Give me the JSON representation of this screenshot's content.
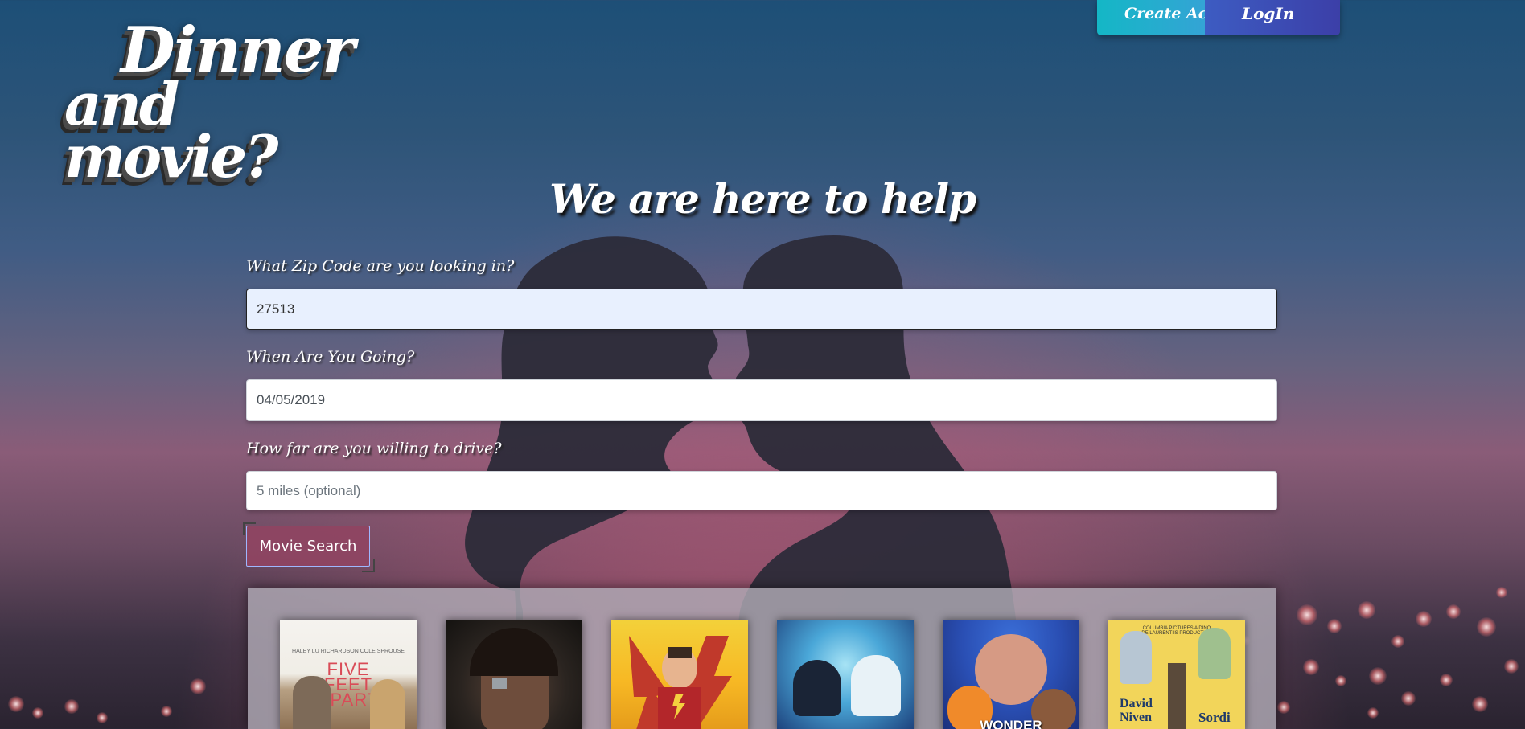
{
  "logo": {
    "line1": "Dinner",
    "line2": "and movie?"
  },
  "nav": {
    "create_account": "Create Account",
    "login": "LogIn"
  },
  "heading": "We are here to help",
  "form": {
    "zip": {
      "label": "What Zip Code are you looking in?",
      "value": "27513"
    },
    "date": {
      "label": "When Are You Going?",
      "value": "04/05/2019"
    },
    "distance": {
      "label": "How far are you willing to drive?",
      "placeholder": "5 miles (optional)"
    },
    "search_button": "Movie Search"
  },
  "posters": [
    {
      "name": "five-feet-apart",
      "title": "FIVE FEET APART",
      "credits": "HALEY LU RICHARDSON  COLE SPROUSE"
    },
    {
      "name": "us",
      "title": ""
    },
    {
      "name": "shazam",
      "title": ""
    },
    {
      "name": "how-to-train-your-dragon",
      "title": ""
    },
    {
      "name": "wonder-park",
      "title": "WONDER"
    },
    {
      "name": "the-best-of-enemies",
      "title": "",
      "credits": "COLUMBIA PICTURES A DINO DE LAURENTIIS PRODUCTION",
      "left_name": "David Niven",
      "right_name": "Sordi"
    }
  ]
}
